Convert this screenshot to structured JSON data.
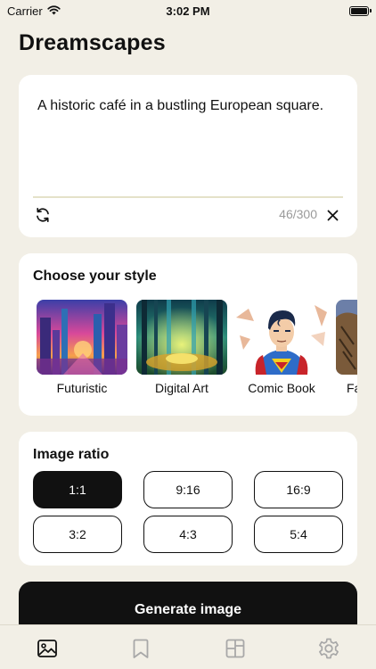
{
  "status_bar": {
    "carrier": "Carrier",
    "time": "3:02 PM"
  },
  "app": {
    "title": "Dreamscapes"
  },
  "prompt": {
    "text": "A historic café in a bustling European square.",
    "char_count": "46/300"
  },
  "styles": {
    "title": "Choose your style",
    "items": [
      {
        "label": "Futuristic"
      },
      {
        "label": "Digital Art"
      },
      {
        "label": "Comic Book"
      },
      {
        "label": "Fa"
      }
    ]
  },
  "ratio": {
    "title": "Image ratio",
    "options": [
      "1:1",
      "9:16",
      "16:9",
      "3:2",
      "4:3",
      "5:4"
    ],
    "selected": "1:1"
  },
  "generate": {
    "label": "Generate image"
  },
  "tab_bar": {
    "items": [
      {
        "icon": "image-icon",
        "active": true
      },
      {
        "icon": "bookmark-icon",
        "active": false
      },
      {
        "icon": "gallery-icon",
        "active": false
      },
      {
        "icon": "gear-icon",
        "active": false
      }
    ]
  },
  "colors": {
    "background": "#F2EFE6",
    "card": "#FFFFFF",
    "primary": "#111111",
    "muted_text": "#9A9A9A",
    "tab_inactive": "#A8A8A8"
  }
}
